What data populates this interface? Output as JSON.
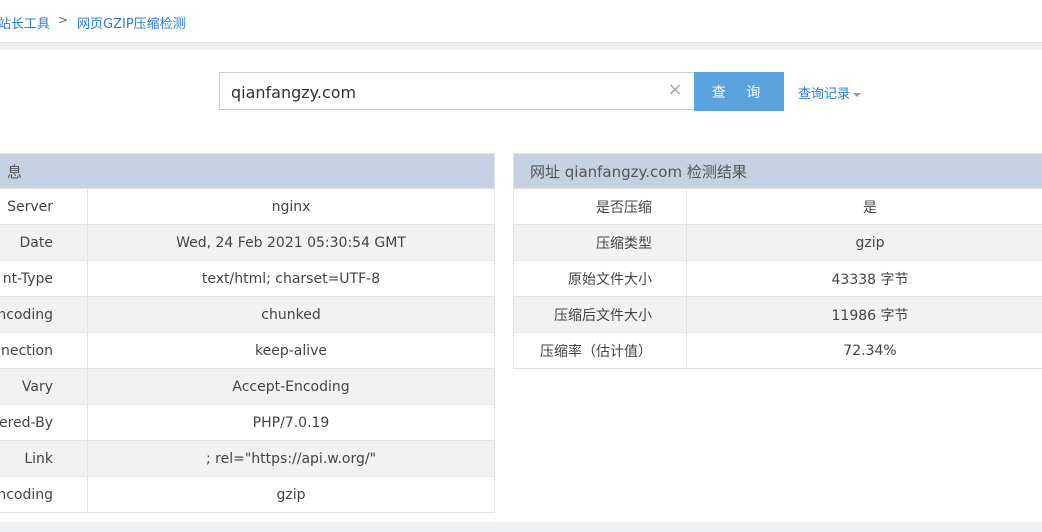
{
  "breadcrumb": {
    "parent": "站长工具",
    "separator": ">",
    "current": "网页GZIP压缩检测"
  },
  "search": {
    "value": "qianfangzy.com",
    "clear_icon": "×",
    "button_label": "查 询",
    "history_label": "查询记录"
  },
  "headers_table": {
    "title": "息",
    "rows": [
      {
        "key": "Server",
        "value": "nginx"
      },
      {
        "key": "Date",
        "value": "Wed, 24 Feb 2021 05:30:54 GMT"
      },
      {
        "key": "nt-Type",
        "value": "text/html; charset=UTF-8"
      },
      {
        "key": "ncoding",
        "value": "chunked"
      },
      {
        "key": "nection",
        "value": "keep-alive"
      },
      {
        "key": "Vary",
        "value": "Accept-Encoding"
      },
      {
        "key": "ered-By",
        "value": "PHP/7.0.19"
      },
      {
        "key": "Link",
        "value": "; rel=\"https://api.w.org/\""
      },
      {
        "key": "ncoding",
        "value": "gzip"
      }
    ]
  },
  "result_table": {
    "title": "网址 qianfangzy.com 检测结果",
    "rows": [
      {
        "key": "是否压缩",
        "value": "是"
      },
      {
        "key": "压缩类型",
        "value": "gzip"
      },
      {
        "key": "原始文件大小",
        "value": "43338 字节"
      },
      {
        "key": "压缩后文件大小",
        "value": "11986 字节"
      },
      {
        "key": "压缩率（估计值）",
        "value": "72.34%"
      }
    ]
  },
  "colors": {
    "link": "#2a7bd8",
    "button": "#5aa3de",
    "table_header": "#c5d1e3"
  }
}
